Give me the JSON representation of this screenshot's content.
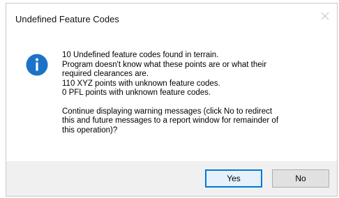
{
  "dialog": {
    "title": "Undefined Feature Codes",
    "icon": "info-icon",
    "accent_color": "#1a73c8",
    "message_lines": [
      "10 Undefined feature codes found in terrain.",
      "Program doesn't know what these points are or what their",
      "required clearances are.",
      "110 XYZ points with unknown feature codes.",
      "0 PFL points with unknown feature codes."
    ],
    "question_lines": [
      "Continue displaying warning messages (click No to redirect",
      "this and future messages to a report window for remainder of",
      "this operation)?"
    ],
    "buttons": {
      "yes_label": "Yes",
      "no_label": "No"
    }
  }
}
